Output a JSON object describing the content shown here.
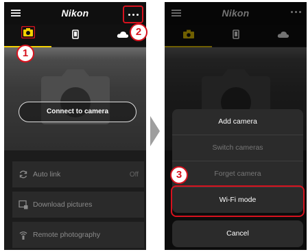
{
  "app": {
    "logo": "Nikon"
  },
  "left": {
    "connect_label": "Connect to camera",
    "menu": [
      {
        "label": "Auto link",
        "value": "Off",
        "icon": "auto-link-icon"
      },
      {
        "label": "Download pictures",
        "value": "",
        "icon": "download-icon"
      },
      {
        "label": "Remote photography",
        "value": "",
        "icon": "remote-icon"
      }
    ]
  },
  "right": {
    "sheet": [
      {
        "label": "Add camera",
        "state": "active"
      },
      {
        "label": "Switch cameras",
        "state": "disabled"
      },
      {
        "label": "Forget camera",
        "state": "disabled"
      },
      {
        "label": "Wi-Fi mode",
        "state": "active"
      }
    ],
    "cancel_label": "Cancel"
  },
  "callouts": {
    "c1": "1",
    "c2": "2",
    "c3": "3"
  },
  "colors": {
    "callout_red": "#d8121e",
    "tab_yellow": "#f5d200",
    "background": "#1c1c1c"
  },
  "tabs": [
    {
      "icon": "camera-icon",
      "selected": true
    },
    {
      "icon": "phone-icon",
      "selected": false
    },
    {
      "icon": "cloud-icon",
      "selected": false
    }
  ]
}
